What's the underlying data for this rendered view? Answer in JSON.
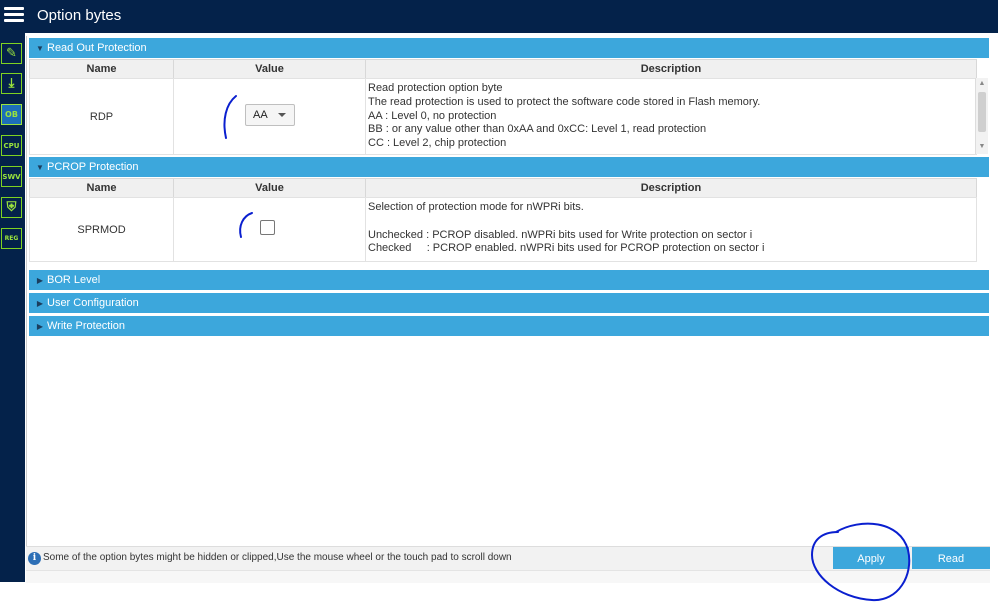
{
  "window": {
    "title": "Option bytes"
  },
  "sidebar": {
    "items": [
      {
        "name": "edit-icon",
        "glyph": "✎"
      },
      {
        "name": "download-icon",
        "glyph": "⤓"
      },
      {
        "name": "ob-icon",
        "glyph": "OB"
      },
      {
        "name": "cpu-icon",
        "glyph": "CPU"
      },
      {
        "name": "swv-icon",
        "glyph": "SWV"
      },
      {
        "name": "security-icon",
        "glyph": "⛨"
      },
      {
        "name": "registers-icon",
        "glyph": "REG"
      }
    ]
  },
  "sections": {
    "rop": {
      "title": "Read Out Protection",
      "expanded": true
    },
    "pcrop": {
      "title": "PCROP Protection",
      "expanded": true
    },
    "bor": {
      "title": "BOR Level",
      "expanded": false
    },
    "user": {
      "title": "User Configuration",
      "expanded": false
    },
    "wp": {
      "title": "Write Protection",
      "expanded": false
    }
  },
  "table": {
    "col_name": "Name",
    "col_value": "Value",
    "col_desc": "Description"
  },
  "rdp": {
    "name": "RDP",
    "value": "AA",
    "description": "Read protection option byte\nThe read protection is used to protect the software code stored in Flash memory.\nAA : Level 0, no protection\nBB : or any value other than 0xAA and 0xCC: Level 1, read protection\nCC : Level 2, chip protection"
  },
  "sprmod": {
    "name": "SPRMOD",
    "checked": false,
    "description": "Selection of protection mode for nWPRi bits.\n\nUnchecked : PCROP disabled. nWPRi bits used for Write protection on sector i\nChecked     : PCROP enabled. nWPRi bits used for PCROP protection on sector i"
  },
  "footer": {
    "info": "Some of the option bytes might be hidden or clipped,Use the mouse wheel or the touch pad to scroll down"
  },
  "buttons": {
    "apply": "Apply",
    "read": "Read"
  },
  "colors": {
    "topbar": "#04224a",
    "section_header": "#3ca7dc",
    "sidebar_icon": "#9be43c",
    "annotation": "#0a1fcf"
  }
}
